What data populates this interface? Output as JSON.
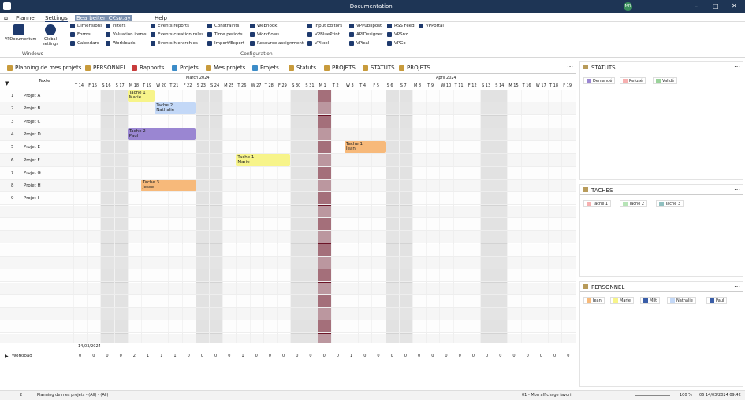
{
  "window": {
    "title": "Documentation_"
  },
  "menu": {
    "items": [
      "Planner",
      "Settings",
      "Help"
    ],
    "highlight": "Bearbeiten C€sø.ay"
  },
  "ribbon": {
    "windows_items": [
      "VPDocumentum",
      "Global settings"
    ],
    "config_items": [
      "Dimensions",
      "Forms",
      "Calendars",
      "Filters",
      "Valuation items",
      "Workloads",
      "Events reports",
      "Events creation rules",
      "Events hierarchies",
      "Constraints",
      "Time periods",
      "Import/Export",
      "Webhook",
      "Workflows",
      "Resource assignment",
      "Input Editors",
      "VPBluePrint",
      "VPlixel",
      "VPPublipost",
      "APIDesigner",
      "VPical",
      "RSS Feed",
      "VPSnz",
      "VPGo",
      "VPPortal"
    ],
    "group_windows": "Windows",
    "group_config": "Configuration"
  },
  "tabs": [
    "Planning de mes projets",
    "PERSONNEL",
    "Rapports",
    "Projets",
    "Mes projets",
    "Projets",
    "Statuts",
    "PROJETS",
    "STATUTS",
    "PROJETS"
  ],
  "grid": {
    "col_header": "Texte",
    "months": [
      "March 2024",
      "April 2024"
    ],
    "days": [
      "T 14",
      "F 15",
      "S 16",
      "S 17",
      "M 18",
      "T 19",
      "W 20",
      "T 21",
      "F 22",
      "S 23",
      "S 24",
      "M 25",
      "T 26",
      "W 27",
      "T 28",
      "F 29",
      "S 30",
      "S 31",
      "M 1",
      "T 2",
      "W 3",
      "T 4",
      "F 5",
      "S 6",
      "S 7",
      "M 8",
      "T 9",
      "W 10",
      "T 11",
      "F 12",
      "S 13",
      "S 14",
      "M 15",
      "T 16",
      "W 17",
      "T 18",
      "F 19"
    ],
    "rows": [
      {
        "n": "1",
        "name": "Projet A"
      },
      {
        "n": "2",
        "name": "Projet B"
      },
      {
        "n": "3",
        "name": "Projet C"
      },
      {
        "n": "4",
        "name": "Projet D"
      },
      {
        "n": "5",
        "name": "Projet E"
      },
      {
        "n": "6",
        "name": "Projet F"
      },
      {
        "n": "7",
        "name": "Projet G"
      },
      {
        "n": "8",
        "name": "Projet H"
      },
      {
        "n": "9",
        "name": "Projet I"
      }
    ]
  },
  "tasks": [
    {
      "title": "Tache 1",
      "person": "Marie",
      "row": 0,
      "start": 4,
      "len": 2,
      "color": "#f7f48a"
    },
    {
      "title": "Tache 2",
      "person": "Nathalie",
      "row": 1,
      "start": 6,
      "len": 3,
      "color": "#c3d8f7"
    },
    {
      "title": "Tache 2",
      "person": "Paul",
      "row": 3,
      "start": 4,
      "len": 5,
      "color": "#9a86d2"
    },
    {
      "title": "Tache 1",
      "person": "Jean",
      "row": 4,
      "start": 20,
      "len": 3,
      "color": "#f7b97a"
    },
    {
      "title": "Tache 1",
      "person": "Marie",
      "row": 5,
      "start": 12,
      "len": 4,
      "color": "#f7f48a"
    },
    {
      "title": "Tache 3",
      "person": "Jesse",
      "row": 7,
      "start": 5,
      "len": 4,
      "color": "#f7b97a"
    }
  ],
  "bottom": {
    "date": "14/03/2024",
    "workload_label": "Workload",
    "workload_values": [
      "0",
      "0",
      "0",
      "0",
      "2",
      "1",
      "1",
      "1",
      "0",
      "0",
      "0",
      "0",
      "1",
      "0",
      "0",
      "0",
      "0",
      "0",
      "0",
      "0",
      "1",
      "0",
      "0",
      "0",
      "0",
      "0",
      "0",
      "0",
      "0",
      "0",
      "0",
      "0",
      "0",
      "0",
      "0",
      "0",
      "0"
    ]
  },
  "panels": {
    "statuts": {
      "title": "STATUTS",
      "chips": [
        {
          "label": "Demandé",
          "color": "#9a86d2"
        },
        {
          "label": "Refusé",
          "color": "#f7b0b0"
        },
        {
          "label": "Validé",
          "color": "#9ad29a"
        }
      ]
    },
    "taches": {
      "title": "TACHES",
      "chips": [
        {
          "label": "Tache 1",
          "color": "#f7b0b0"
        },
        {
          "label": "Tache 2",
          "color": "#b7e4b7"
        },
        {
          "label": "Tache 3",
          "color": "#8fbfbf"
        }
      ]
    },
    "personnel": {
      "title": "PERSONNEL",
      "chips": [
        {
          "label": "Jean",
          "color": "#f7b97a"
        },
        {
          "label": "Marie",
          "color": "#f7f48a"
        },
        {
          "label": "Milt",
          "color": "#3a5ea8"
        },
        {
          "label": "Nathalie",
          "color": "#c3d8f7"
        },
        {
          "label": "Paul",
          "color": "#3a5ea8"
        }
      ]
    }
  },
  "status": {
    "left_count": "2",
    "planning": "Planning de mes projets - (All) - (All)",
    "fav": "01 - Mon affichage favori",
    "zoom": "100 %",
    "datetime": "06 14/03/2024 09:42"
  },
  "colors": {
    "weekend": "#d3d3d3",
    "today": "#6b1326",
    "titlebar": "#1e3555"
  }
}
